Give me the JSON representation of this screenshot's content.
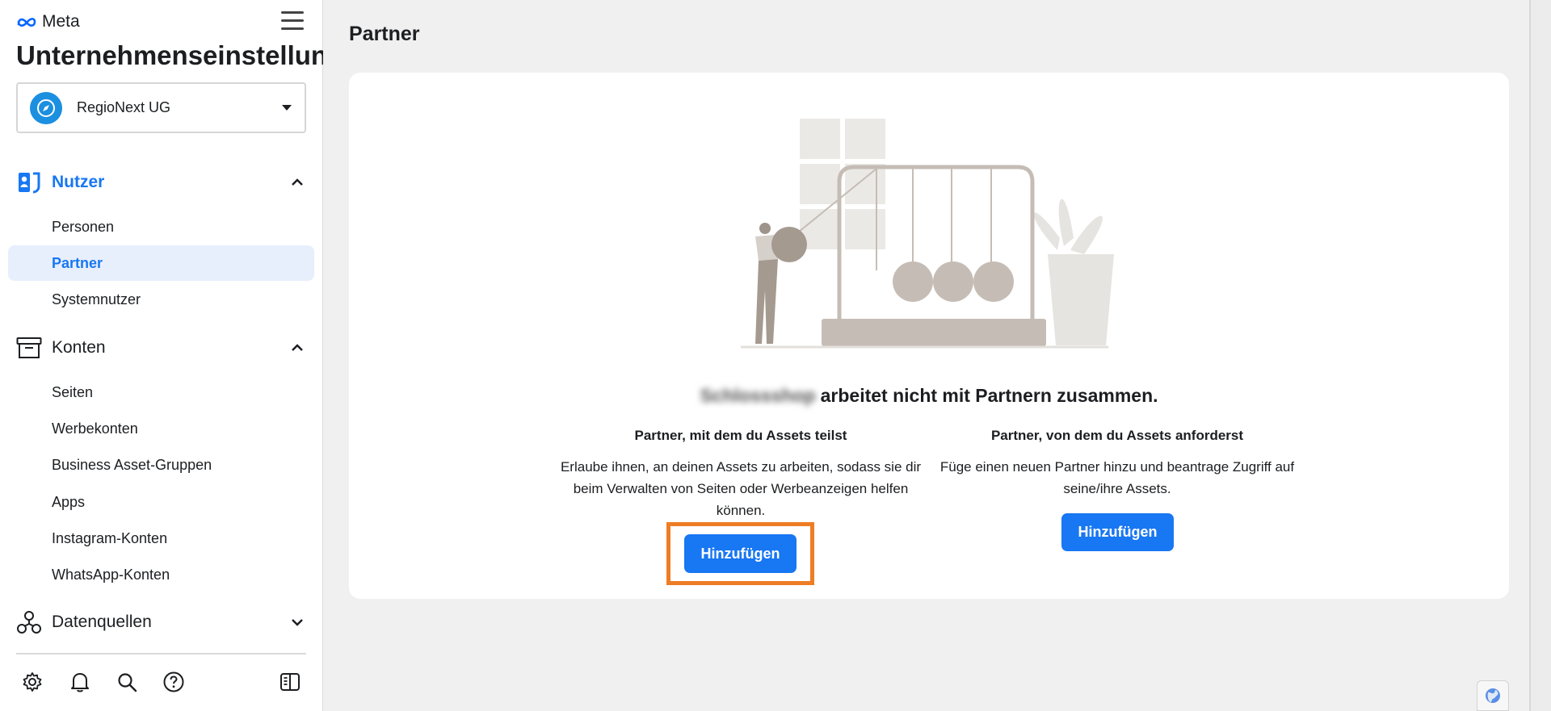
{
  "header": {
    "brand": "Meta",
    "app_title": "Unternehmenseinstellungen",
    "business_name": "RegioNext UG"
  },
  "sidebar": {
    "sections": [
      {
        "label": "Nutzer",
        "icon": "users-id-icon",
        "expanded": true,
        "items": [
          "Personen",
          "Partner",
          "Systemnutzer"
        ]
      },
      {
        "label": "Konten",
        "icon": "archive-box-icon",
        "expanded": true,
        "items": [
          "Seiten",
          "Werbekonten",
          "Business Asset-Gruppen",
          "Apps",
          "Instagram-Konten",
          "WhatsApp-Konten"
        ]
      },
      {
        "label": "Datenquellen",
        "icon": "data-sources-icon",
        "expanded": false,
        "items": []
      }
    ],
    "active_item": "Partner",
    "footer_icons": [
      "settings-icon",
      "bell-icon",
      "search-icon",
      "help-icon",
      "panel-toggle-icon"
    ]
  },
  "main": {
    "page_title": "Partner",
    "headline_blurred": "Schlossshop",
    "headline": "arbeitet nicht mit Partnern zusammen.",
    "share": {
      "title": "Partner, mit dem du Assets teilst",
      "description": "Erlaube ihnen, an deinen Assets zu arbeiten, sodass sie dir beim Verwalten von Seiten oder Werbeanzeigen helfen können.",
      "button": "Hinzufügen"
    },
    "request": {
      "title": "Partner, von dem du Assets anforderst",
      "description": "Füge einen neuen Partner hinzu und beantrage Zugriff auf seine/ihre Assets.",
      "button": "Hinzufügen"
    }
  },
  "colors": {
    "accent": "#1877f2",
    "active_bg": "#e7effd",
    "highlight": "#ee7d24",
    "avatar": "#1b8fe0"
  }
}
